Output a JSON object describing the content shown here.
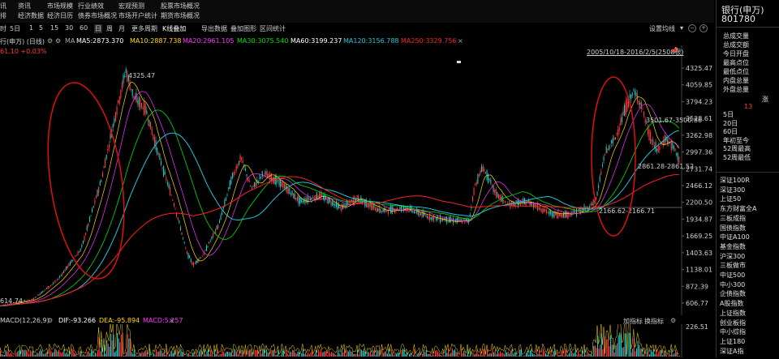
{
  "menu": {
    "col1": [
      "资讯",
      "经济数据"
    ],
    "col2": [
      "市场规模",
      "经济日历"
    ],
    "col3": [
      "行业绩效",
      "债券市场概况"
    ],
    "col4": [
      "宏观预测",
      "市场开户统计"
    ],
    "col5": [
      "股票市场概况",
      "期货市场概况"
    ],
    "partial_left": "讯",
    "partial_left2": "排"
  },
  "toolbar": {
    "items": [
      "时",
      "5日",
      "1",
      "5",
      "15",
      "30",
      "60",
      "日",
      "周",
      "月",
      "更多周期",
      "K线叠加",
      "导出数据",
      "叠加图形",
      "区间统计"
    ],
    "settings": "设置均线"
  },
  "legend": {
    "name": "行(申万) (日线)",
    "ma": "MA",
    "ma5": "MA5:2873.370",
    "ma10": "MA10:2887.738",
    "ma20": "MA20:2961.105",
    "ma30": "MA30:3075.540",
    "ma60": "MA60:3199.237",
    "ma120": "MA120:3156.788",
    "ma250": "MA250:3329.756",
    "change": "61.10 +0.03%",
    "range": "2005/10/18-2016/2/5(2508根)"
  },
  "colors": {
    "ma5": "#ffffff",
    "ma10": "#ffd800",
    "ma20": "#ff33ff",
    "ma30": "#00e000",
    "ma60": "#ffffff",
    "ma120": "#1ec8d8",
    "ma250": "#ff2020",
    "up": "#ff3b3b",
    "down": "#23c9c9",
    "annotation": "#e01010"
  },
  "y_axis": [
    "4325.47",
    "4059.85",
    "3794.23",
    "3528.61",
    "3262.98",
    "2997.36",
    "2731.74",
    "2466.12",
    "2200.50",
    "1934.87",
    "1669.25",
    "1403.63",
    "1138.01",
    "872.39",
    "606.77"
  ],
  "annotations": {
    "peak": "4325.47",
    "low_left": "614.74",
    "level1": "2166.62-2166.71",
    "level2": "2861.28-2861.52",
    "level3": "3501.67-3500.86"
  },
  "macd": {
    "label": "MACD(12,26,9)",
    "dif": "DIF:-93.266",
    "dea": "DEA:-95.894",
    "macd": "MACD:5.257",
    "buttons": [
      "加指标",
      "换指标"
    ],
    "axis": "226.51"
  },
  "sidebar": {
    "title": "银行(申万)",
    "code": "801780",
    "stats": [
      "总成交量",
      "总成交额",
      "今日开盘",
      "最高点位",
      "最低点位",
      "内盘总量",
      "外盘总量"
    ],
    "rise_label": "涨",
    "rise_count": "13",
    "periods": [
      "5日",
      "20日",
      "60日",
      "年初至今",
      "52周最高",
      "52周最低"
    ],
    "indices": [
      "深证100R",
      "深证300",
      "上证50",
      "东方财富全A",
      "三板成指",
      "国债指数",
      "中证A100",
      "基金指数",
      "沪深300",
      "三板做市",
      "中证500",
      "中小300",
      "企债指数",
      "A股指数",
      "上证指数",
      "创业板指",
      "中小综指",
      "上证180",
      "深证A指"
    ]
  }
}
